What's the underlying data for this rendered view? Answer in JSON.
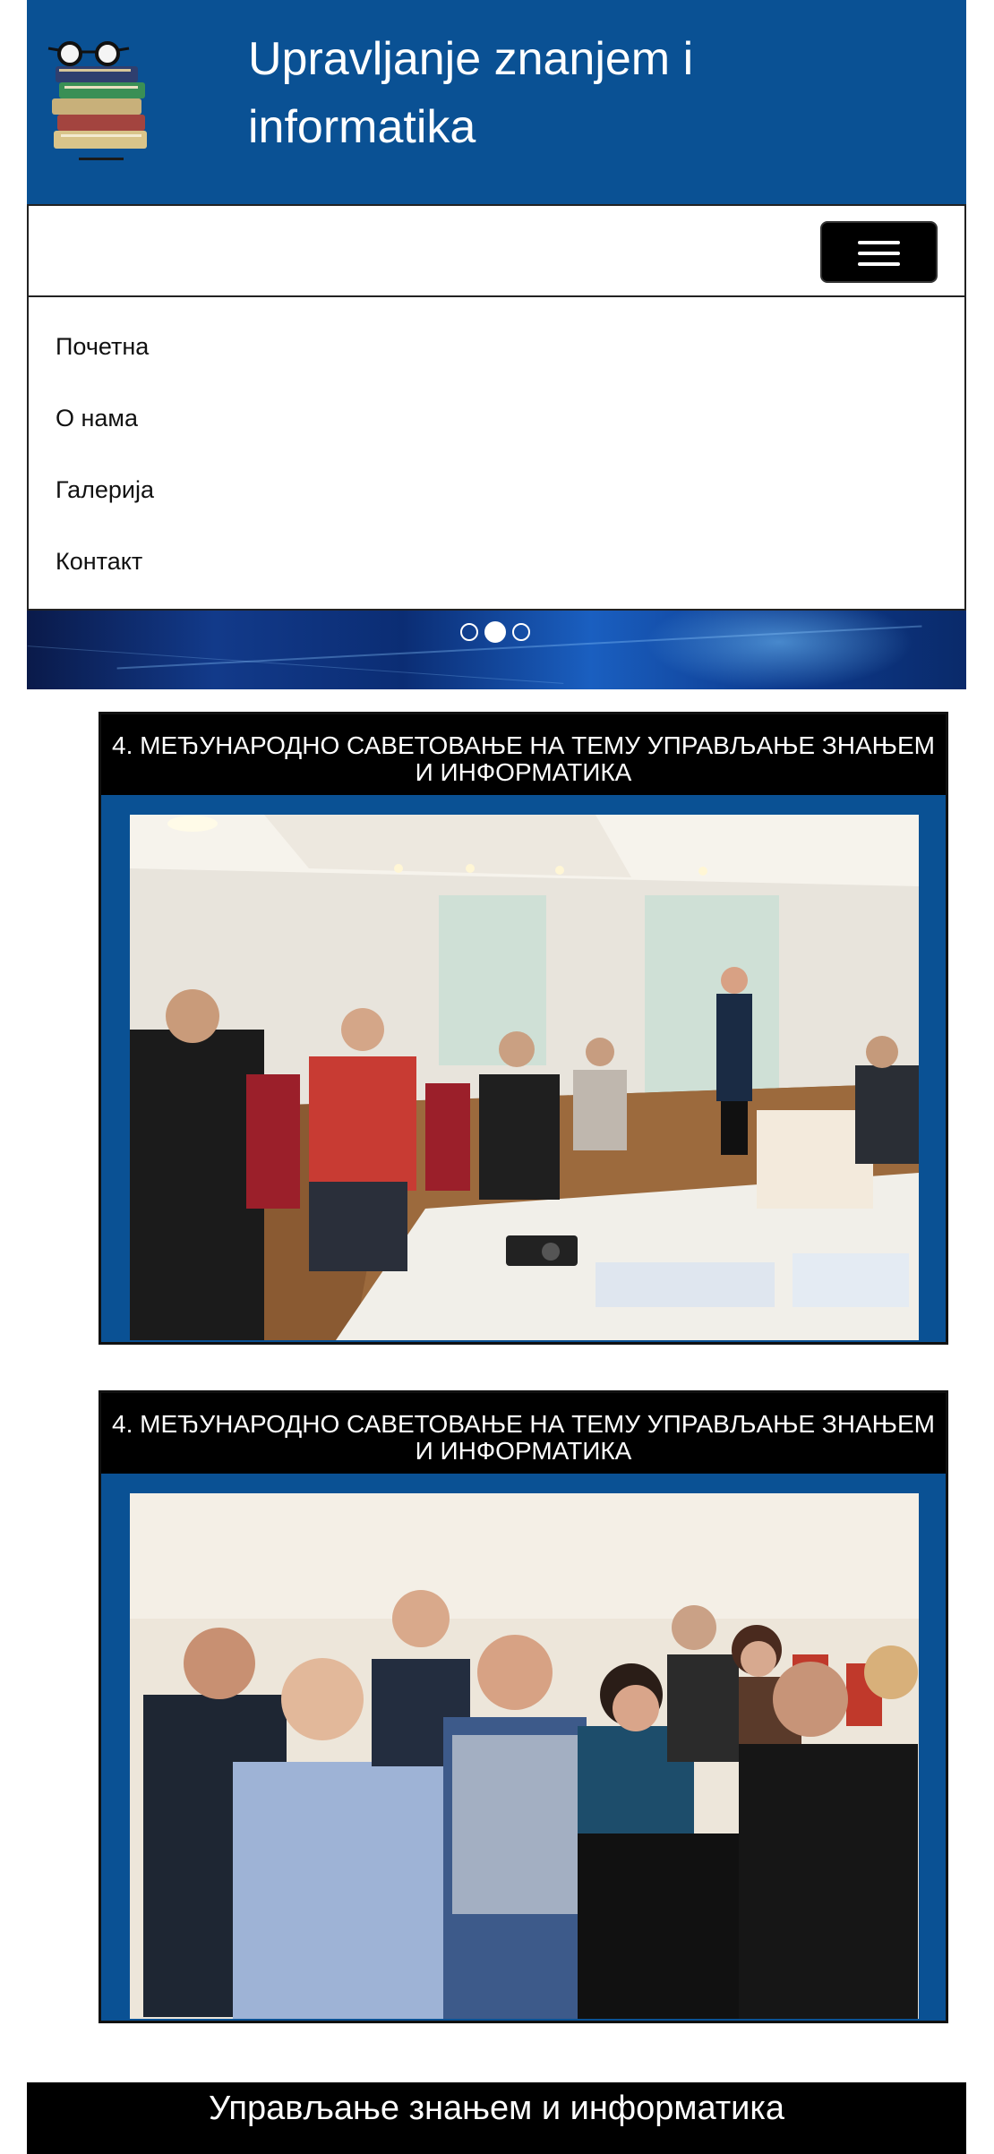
{
  "header": {
    "title": "Upravljanje znanjem i informatika",
    "logo_icon": "books-with-glasses-icon"
  },
  "navbar": {
    "toggle_icon": "hamburger-menu-icon",
    "menu": [
      {
        "label": "Почетна"
      },
      {
        "label": "О нама"
      },
      {
        "label": "Галерија"
      },
      {
        "label": "Контакт"
      }
    ]
  },
  "slider": {
    "dots": 3,
    "active_dot": 2
  },
  "cards": [
    {
      "title": "4. МЕЂУНАРОДНО САВЕТОВАЊЕ НА ТЕМУ УПРАВЉАЊЕ ЗНАЊЕМ И ИНФОРМАТИКА"
    },
    {
      "title": "4. МЕЂУНАРОДНО САВЕТОВАЊЕ НА ТЕМУ УПРАВЉАЊЕ ЗНАЊЕМ И ИНФОРМАТИКА"
    }
  ],
  "footer": {
    "text": "Управљање знањем и информатика"
  },
  "colors": {
    "primary_blue": "#0a5194",
    "black": "#000000",
    "white": "#ffffff"
  }
}
